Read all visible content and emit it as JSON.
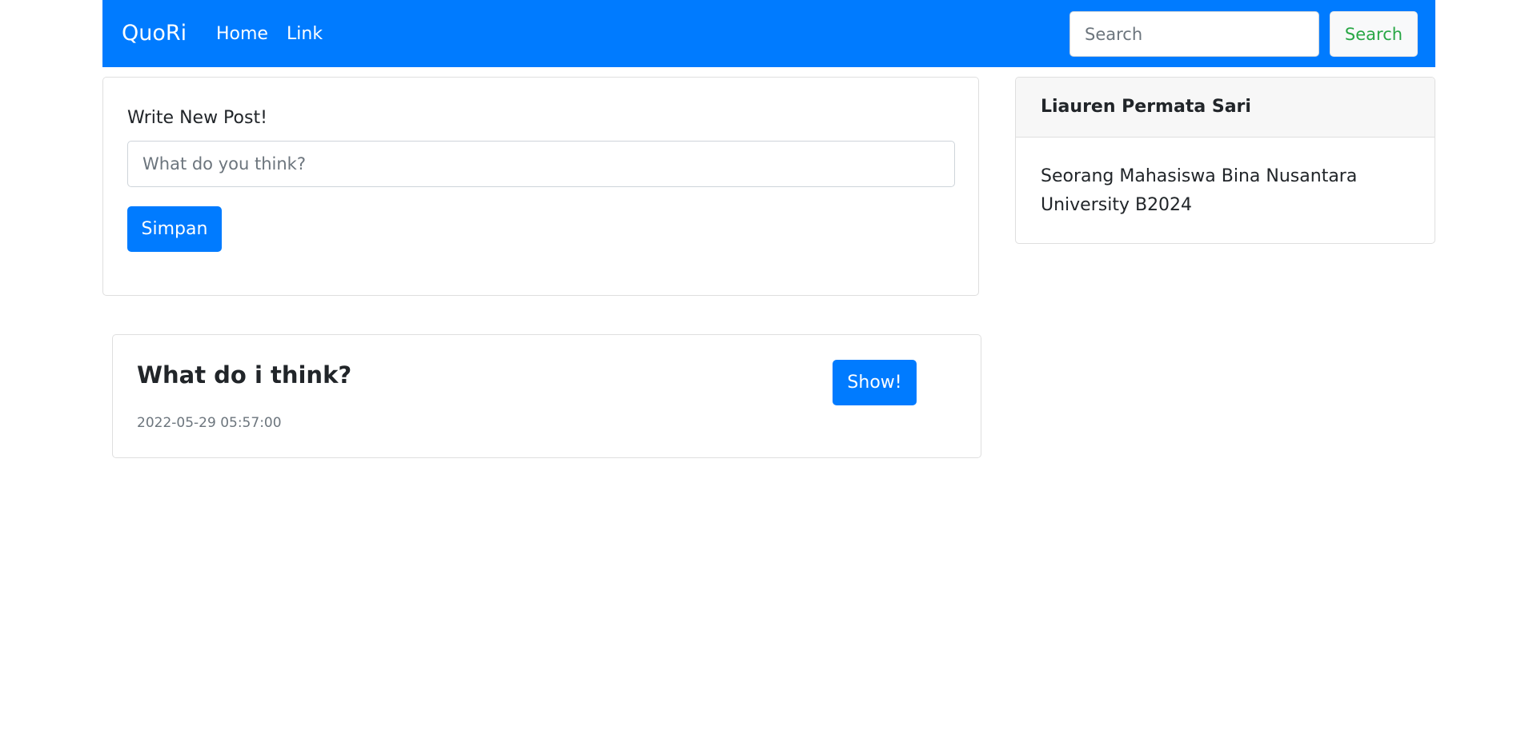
{
  "navbar": {
    "brand": "QuoRi",
    "links": [
      "Home",
      "Link"
    ],
    "search_placeholder": "Search",
    "search_button": "Search"
  },
  "new_post": {
    "label": "Write New Post!",
    "placeholder": "What do you think?",
    "submit_label": "Simpan"
  },
  "profile": {
    "name": "Liauren Permata Sari",
    "bio": "Seorang Mahasiswa Bina Nusantara University B2024"
  },
  "posts": [
    {
      "title": "What do i think?",
      "timestamp": "2022-05-29 05:57:00",
      "button_label": "Show!"
    }
  ],
  "colors": {
    "primary": "#007bff",
    "search_button_text": "#28a745",
    "muted": "#6c757d"
  }
}
